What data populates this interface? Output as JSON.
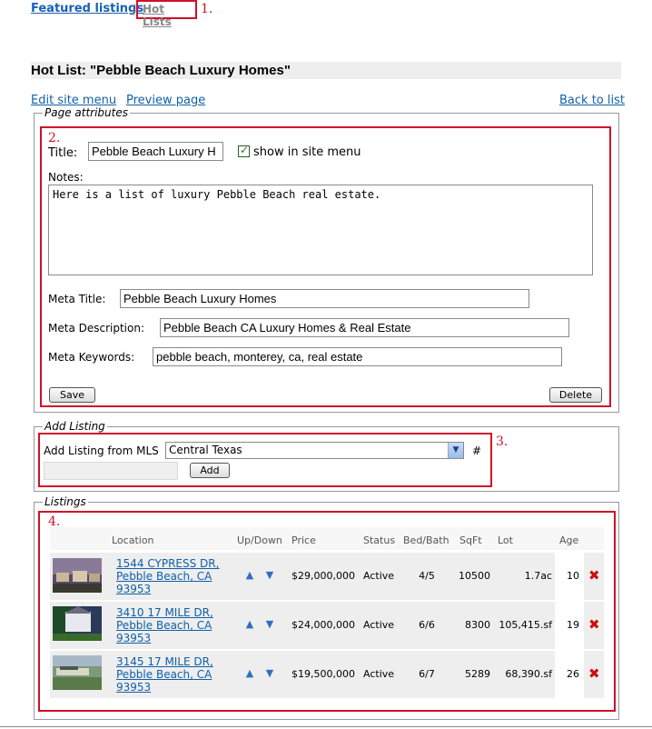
{
  "tabs": {
    "featured": "Featured listings",
    "separator": "|",
    "hot": "Hot Lists"
  },
  "markers": {
    "m1": "1.",
    "m2": "2.",
    "m3": "3.",
    "m4": "4."
  },
  "page_title": "Hot List: \"Pebble Beach Luxury Homes\"",
  "top_links": {
    "edit_menu": "Edit site menu",
    "preview": "Preview page",
    "back": "Back to list"
  },
  "attributes": {
    "legend": "Page attributes",
    "title_label": "Title:",
    "title_value": "Pebble Beach Luxury H",
    "show_in_menu_label": "show in site menu",
    "show_in_menu_checked": true,
    "notes_label": "Notes:",
    "notes_value": "Here is a list of luxury Pebble Beach real estate.",
    "meta_title_label": "Meta Title:",
    "meta_title_value": "Pebble Beach Luxury Homes",
    "meta_desc_label": "Meta Description:",
    "meta_desc_value": "Pebble Beach CA Luxury Homes & Real Estate",
    "meta_keywords_label": "Meta Keywords:",
    "meta_keywords_value": "pebble beach, monterey, ca, real estate",
    "save_label": "Save",
    "delete_label": "Delete"
  },
  "add_listing": {
    "legend": "Add Listing",
    "label": "Add Listing from MLS",
    "mls_selected": "Central Texas",
    "hash_label": "#",
    "add_label": "Add"
  },
  "listings": {
    "legend": "Listings",
    "headers": {
      "location": "Location",
      "updown": "Up/Down",
      "price": "Price",
      "status": "Status",
      "bedbath": "Bed/Bath",
      "sqft": "SqFt",
      "lot": "Lot",
      "age": "Age"
    },
    "rows": [
      {
        "addr1": "1544 CYPRESS DR,",
        "addr2": "Pebble Beach, CA",
        "addr3": "93953",
        "price": "$29,000,000",
        "status": "Active",
        "bedbath": "4/5",
        "sqft": "10500",
        "lot": "1.7ac",
        "age": "10"
      },
      {
        "addr1": "3410 17 MILE DR,",
        "addr2": "Pebble Beach, CA",
        "addr3": "93953",
        "price": "$24,000,000",
        "status": "Active",
        "bedbath": "6/6",
        "sqft": "8300",
        "lot": "105,415.sf",
        "age": "19"
      },
      {
        "addr1": "3145 17 MILE DR,",
        "addr2": "Pebble Beach, CA",
        "addr3": "93953",
        "price": "$19,500,000",
        "status": "Active",
        "bedbath": "6/7",
        "sqft": "5289",
        "lot": "68,390.sf",
        "age": "26"
      }
    ]
  },
  "colors": {
    "marker_red": "#d0102a",
    "link_blue": "#1060a8",
    "delete_red": "#cc1010"
  }
}
